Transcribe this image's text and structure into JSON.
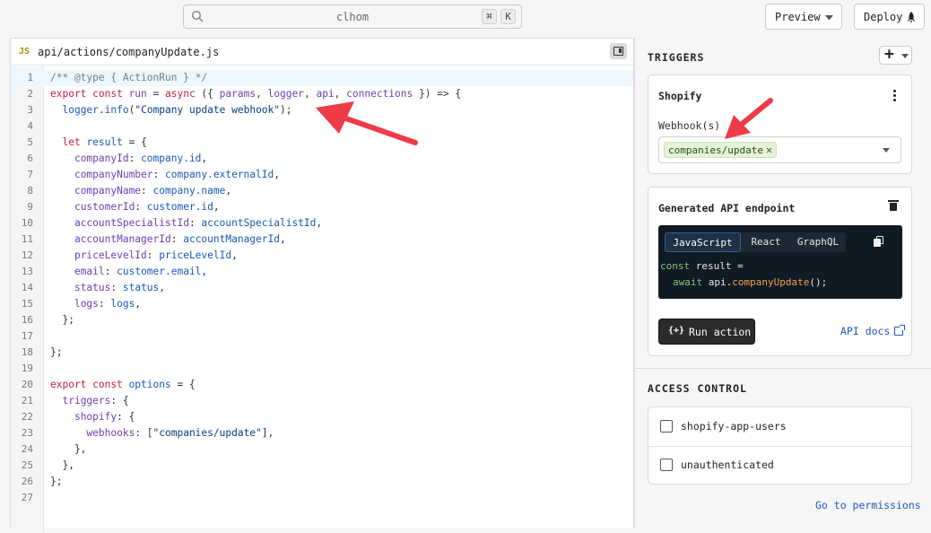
{
  "topbar": {
    "search_text": "clhom",
    "shortcut_cmd": "⌘",
    "shortcut_key": "K",
    "preview_label": "Preview",
    "deploy_label": "Deploy"
  },
  "editor": {
    "file_badge": "JS",
    "file_name": "api/actions/companyUpdate.js",
    "active_line": 1,
    "lines": [
      [
        [
          "cm",
          "/** @type { ActionRun } */"
        ]
      ],
      [
        [
          "kw",
          "export const "
        ],
        [
          "fn",
          "run"
        ],
        [
          "pl",
          " = "
        ],
        [
          "kw",
          "async"
        ],
        [
          "pl",
          " ({ "
        ],
        [
          "fn",
          "params"
        ],
        [
          "pl",
          ", "
        ],
        [
          "fn",
          "logger"
        ],
        [
          "pl",
          ", "
        ],
        [
          "fn",
          "api"
        ],
        [
          "pl",
          ", "
        ],
        [
          "fn",
          "connections"
        ],
        [
          "pl",
          " }) => {"
        ]
      ],
      [
        [
          "pl",
          "  "
        ],
        [
          "pr",
          "logger"
        ],
        [
          "pl",
          "."
        ],
        [
          "pr",
          "info"
        ],
        [
          "pl",
          "("
        ],
        [
          "st",
          "\"Company update webhook\""
        ],
        [
          "pl",
          ");"
        ]
      ],
      [],
      [
        [
          "pl",
          "  "
        ],
        [
          "kw",
          "let "
        ],
        [
          "pr",
          "result"
        ],
        [
          "pl",
          " = {"
        ]
      ],
      [
        [
          "pl",
          "    "
        ],
        [
          "fn",
          "companyId"
        ],
        [
          "pl",
          ": "
        ],
        [
          "pr",
          "company.id"
        ],
        [
          "pl",
          ","
        ]
      ],
      [
        [
          "pl",
          "    "
        ],
        [
          "fn",
          "companyNumber"
        ],
        [
          "pl",
          ": "
        ],
        [
          "pr",
          "company.externalId"
        ],
        [
          "pl",
          ","
        ]
      ],
      [
        [
          "pl",
          "    "
        ],
        [
          "fn",
          "companyName"
        ],
        [
          "pl",
          ": "
        ],
        [
          "pr",
          "company.name"
        ],
        [
          "pl",
          ","
        ]
      ],
      [
        [
          "pl",
          "    "
        ],
        [
          "fn",
          "customerId"
        ],
        [
          "pl",
          ": "
        ],
        [
          "pr",
          "customer.id"
        ],
        [
          "pl",
          ","
        ]
      ],
      [
        [
          "pl",
          "    "
        ],
        [
          "fn",
          "accountSpecialistId"
        ],
        [
          "pl",
          ": "
        ],
        [
          "pr",
          "accountSpecialistId"
        ],
        [
          "pl",
          ","
        ]
      ],
      [
        [
          "pl",
          "    "
        ],
        [
          "fn",
          "accountManagerId"
        ],
        [
          "pl",
          ": "
        ],
        [
          "pr",
          "accountManagerId"
        ],
        [
          "pl",
          ","
        ]
      ],
      [
        [
          "pl",
          "    "
        ],
        [
          "fn",
          "priceLevelId"
        ],
        [
          "pl",
          ": "
        ],
        [
          "pr",
          "priceLevelId"
        ],
        [
          "pl",
          ","
        ]
      ],
      [
        [
          "pl",
          "    "
        ],
        [
          "fn",
          "email"
        ],
        [
          "pl",
          ": "
        ],
        [
          "pr",
          "customer.email"
        ],
        [
          "pl",
          ","
        ]
      ],
      [
        [
          "pl",
          "    "
        ],
        [
          "fn",
          "status"
        ],
        [
          "pl",
          ": "
        ],
        [
          "pr",
          "status"
        ],
        [
          "pl",
          ","
        ]
      ],
      [
        [
          "pl",
          "    "
        ],
        [
          "fn",
          "logs"
        ],
        [
          "pl",
          ": "
        ],
        [
          "pr",
          "logs"
        ],
        [
          "pl",
          ","
        ]
      ],
      [
        [
          "pl",
          "  };"
        ]
      ],
      [],
      [
        [
          "pl",
          "};"
        ]
      ],
      [],
      [
        [
          "kw",
          "export const "
        ],
        [
          "pr",
          "options"
        ],
        [
          "pl",
          " = {"
        ]
      ],
      [
        [
          "pl",
          "  "
        ],
        [
          "fn",
          "triggers"
        ],
        [
          "pl",
          ": {"
        ]
      ],
      [
        [
          "pl",
          "    "
        ],
        [
          "fn",
          "shopify"
        ],
        [
          "pl",
          ": {"
        ]
      ],
      [
        [
          "pl",
          "      "
        ],
        [
          "fn",
          "webhooks"
        ],
        [
          "pl",
          ": ["
        ],
        [
          "st",
          "\"companies/update\""
        ],
        [
          "pl",
          "],"
        ]
      ],
      [
        [
          "pl",
          "    },"
        ]
      ],
      [
        [
          "pl",
          "  },"
        ]
      ],
      [
        [
          "pl",
          "};"
        ]
      ],
      []
    ]
  },
  "triggers": {
    "title": "TRIGGERS",
    "add_label": "+",
    "shopify": {
      "title": "Shopify",
      "webhooks_label": "Webhook(s)",
      "selected_webhook": "companies/update"
    },
    "endpoint": {
      "title": "Generated API endpoint",
      "tabs": [
        "JavaScript",
        "React",
        "GraphQL"
      ],
      "selected_tab": "JavaScript",
      "snippet_line1_kw": "const",
      "snippet_line1_rest": " result =",
      "snippet_line2_kw": "await",
      "snippet_line2_obj": " api.",
      "snippet_line2_method": "companyUpdate",
      "snippet_line2_end": "();",
      "run_icon": "{+}",
      "run_label": "Run action",
      "docs_label": "API docs"
    }
  },
  "access": {
    "title": "ACCESS CONTROL",
    "roles": [
      {
        "label": "shopify-app-users",
        "checked": false
      },
      {
        "label": "unauthenticated",
        "checked": false
      }
    ],
    "permissions_link": "Go to permissions"
  },
  "colors": {
    "arrow": "#ef3a47",
    "keyword": "#c4223a",
    "identifier": "#6b3fb0",
    "property": "#1f55b8",
    "link": "#1f55b8",
    "chip_bg": "#e6f2d9"
  }
}
